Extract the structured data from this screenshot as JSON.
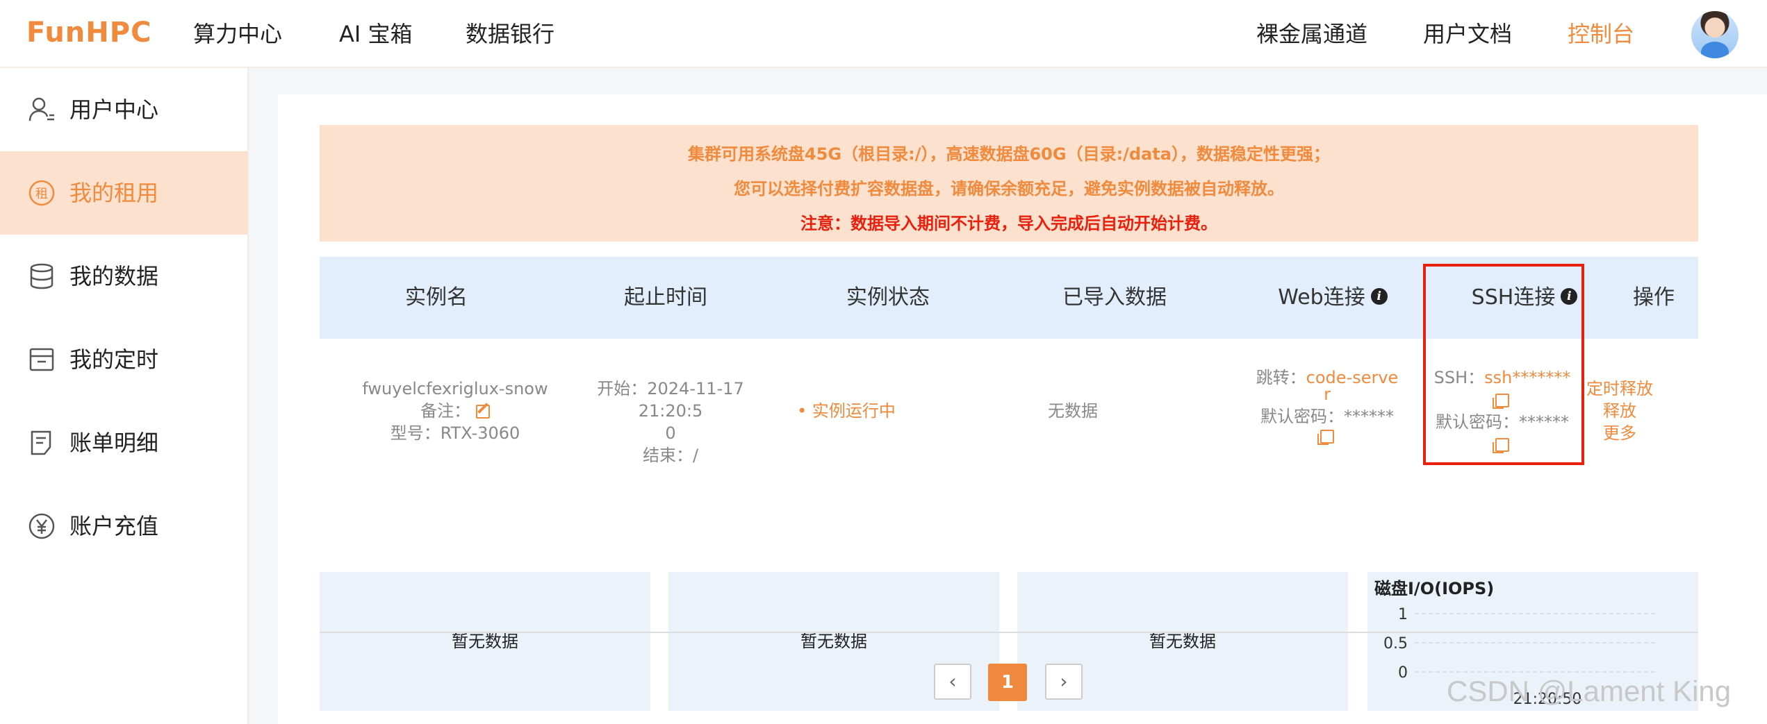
{
  "header": {
    "logo_part1": "FunHPC",
    "nav_left": [
      "算力中心",
      "AI 宝箱",
      "数据银行"
    ],
    "nav_right": [
      "裸金属通道",
      "用户文档",
      "控制台"
    ],
    "active_nav": "控制台"
  },
  "sidebar": {
    "items": [
      {
        "label": "用户中心",
        "icon": "user-icon"
      },
      {
        "label": "我的租用",
        "icon": "rent-icon"
      },
      {
        "label": "我的数据",
        "icon": "database-icon"
      },
      {
        "label": "我的定时",
        "icon": "timer-box-icon"
      },
      {
        "label": "账单明细",
        "icon": "bill-icon"
      },
      {
        "label": "账户充值",
        "icon": "yen-icon"
      }
    ],
    "active": "我的租用",
    "rent_icon_char": "租"
  },
  "notice": {
    "line1": "集群可用系统盘45G（根目录:/），高速数据盘60G（目录:/data），数据稳定性更强；",
    "line2": "您可以选择付费扩容数据盘，请确保余额充足，避免实例数据被自动释放。",
    "line3": "注意：数据导入期间不计费，导入完成后自动开始计费。"
  },
  "table": {
    "headers": {
      "name": "实例名",
      "time": "起止时间",
      "status": "实例状态",
      "data": "已导入数据",
      "web": "Web连接",
      "ssh": "SSH连接",
      "ops": "操作"
    },
    "row": {
      "instance_name": "fwuyelcfexriglux-snow",
      "remark_label": "备注：",
      "model": "型号：RTX-3060",
      "start_line1": "开始：2024-11-17 21:20:5",
      "start_line2": "0",
      "end": "结束：/",
      "status": "• 实例运行中",
      "imported": "无数据",
      "web_jump_label": "跳转：",
      "web_jump_link1": "code-serve",
      "web_jump_link2": "r",
      "web_password": "默认密码：******",
      "ssh_label": "SSH：",
      "ssh_value": "ssh*******",
      "ssh_password": "默认密码：******",
      "op_timer": "定时释放",
      "op_release": "释放",
      "op_more": "更多"
    }
  },
  "panels": {
    "empty_text": "暂无数据",
    "chart_title": "磁盘I/O(IOPS)"
  },
  "chart_data": {
    "type": "line",
    "title": "磁盘I/O(IOPS)",
    "x": [
      "21:20:50"
    ],
    "yticks": [
      "1",
      "0.5",
      "0"
    ],
    "ylim": [
      0,
      1
    ],
    "series": [],
    "grid": true
  },
  "pagination": {
    "current": "1",
    "prev": "‹",
    "next": "›"
  },
  "watermark": "CSDN @Lament King",
  "colors": {
    "accent": "#f08a3c",
    "alert": "#e8200e",
    "table_header_bg": "#e2eefb",
    "notice_bg": "#fde1cf"
  }
}
